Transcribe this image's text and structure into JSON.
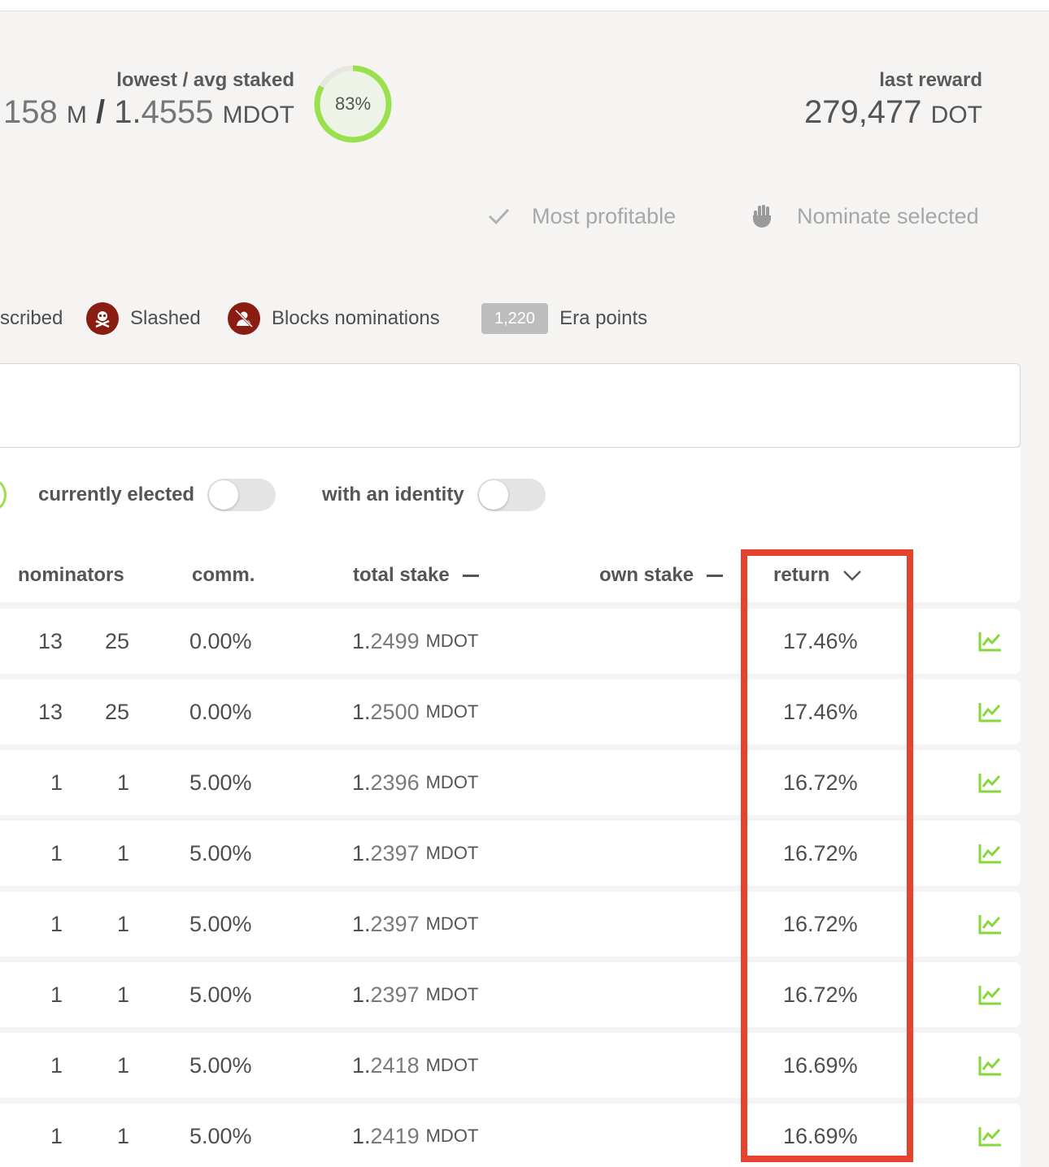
{
  "summary": {
    "staked_label": "lowest / avg staked",
    "staked_lowest_faint": "158",
    "staked_lowest_unit": "M",
    "staked_sep": "/",
    "staked_avg_int": "1.",
    "staked_avg_frac": "4555",
    "staked_avg_unit": "MDOT",
    "ratio_label": "83%",
    "ratio_percent": 83,
    "reward_label": "last reward",
    "reward_value": "279,477",
    "reward_unit": "DOT"
  },
  "actions": {
    "most_profitable": "Most profitable",
    "nominate_selected": "Nominate selected"
  },
  "legend": {
    "subscribed_partial": "scribed",
    "slashed": "Slashed",
    "blocks_nominations": "Blocks nominations",
    "era_points_badge": "1,220",
    "era_points": "Era points"
  },
  "filters": {
    "currently_elected": "currently elected",
    "with_identity": "with an identity"
  },
  "table": {
    "headers": {
      "nominators": "nominators",
      "comm": "comm.",
      "total_stake": "total stake",
      "own_stake": "own stake",
      "return": "return"
    },
    "rows": [
      {
        "nom_a": "13",
        "nom_b": "25",
        "comm": "0.00%",
        "total_int": "1.",
        "total_frac": "2499",
        "total_unit": "MDOT",
        "ret": "17.46%"
      },
      {
        "nom_a": "13",
        "nom_b": "25",
        "comm": "0.00%",
        "total_int": "1.",
        "total_frac": "2500",
        "total_unit": "MDOT",
        "ret": "17.46%"
      },
      {
        "nom_a": "1",
        "nom_b": "1",
        "comm": "5.00%",
        "total_int": "1.",
        "total_frac": "2396",
        "total_unit": "MDOT",
        "ret": "16.72%"
      },
      {
        "nom_a": "1",
        "nom_b": "1",
        "comm": "5.00%",
        "total_int": "1.",
        "total_frac": "2397",
        "total_unit": "MDOT",
        "ret": "16.72%"
      },
      {
        "nom_a": "1",
        "nom_b": "1",
        "comm": "5.00%",
        "total_int": "1.",
        "total_frac": "2397",
        "total_unit": "MDOT",
        "ret": "16.72%"
      },
      {
        "nom_a": "1",
        "nom_b": "1",
        "comm": "5.00%",
        "total_int": "1.",
        "total_frac": "2397",
        "total_unit": "MDOT",
        "ret": "16.72%"
      },
      {
        "nom_a": "1",
        "nom_b": "1",
        "comm": "5.00%",
        "total_int": "1.",
        "total_frac": "2418",
        "total_unit": "MDOT",
        "ret": "16.69%"
      },
      {
        "nom_a": "1",
        "nom_b": "1",
        "comm": "5.00%",
        "total_int": "1.",
        "total_frac": "2419",
        "total_unit": "MDOT",
        "ret": "16.69%"
      }
    ]
  },
  "colors": {
    "accent_green": "#9ae04c",
    "chart_icon_green": "#86d83a",
    "badge_red": "#8a1c12",
    "highlight_red": "#e5432d"
  }
}
